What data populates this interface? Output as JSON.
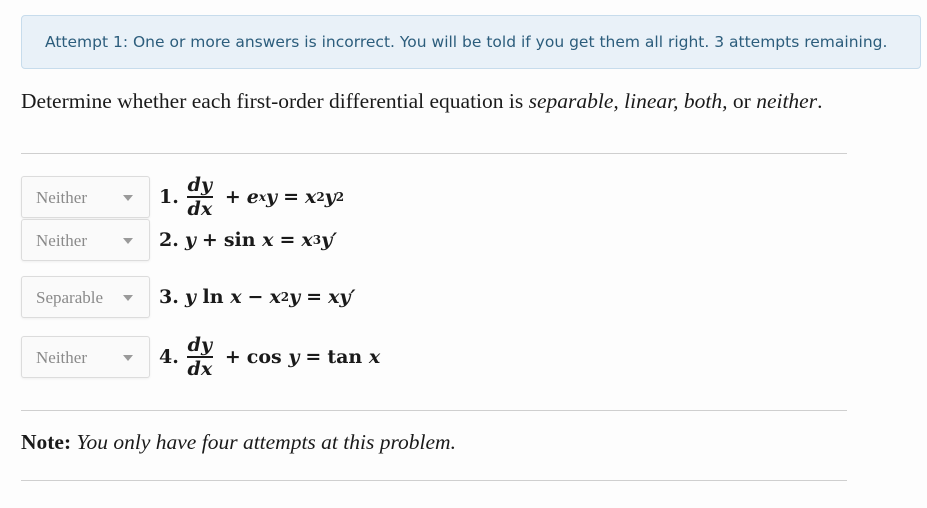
{
  "alert": {
    "text": "Attempt 1: One or more answers is incorrect. You will be told if you get them all right. 3 attempts remaining."
  },
  "question": {
    "prefix": "Determine whether each first-order differential equation is ",
    "opt1": "separable,",
    "opt2": "linear,",
    "opt3": "both,",
    "or": " or ",
    "opt4": "neither",
    "suffix": "."
  },
  "items": [
    {
      "number": "1.",
      "answer": "Neither"
    },
    {
      "number": "2.",
      "answer": "Neither"
    },
    {
      "number": "3.",
      "answer": "Separable"
    },
    {
      "number": "4.",
      "answer": "Neither"
    }
  ],
  "equations": {
    "e1": {
      "num": "dy",
      "den": "dx",
      "plus": "+",
      "e": "e",
      "x_sup": "x",
      "y": "y",
      "eq": "=",
      "x": "x",
      "two_a": "2",
      "y2": "y",
      "two_b": "2"
    },
    "e2": {
      "y": "y",
      "plus": "+",
      "sin": "sin",
      "x": "x",
      "eq": "=",
      "x2": "x",
      "three": "3",
      "yp": "y′"
    },
    "e3": {
      "y": "y",
      "ln": "ln",
      "x": "x",
      "minus": "−",
      "x2": "x",
      "two": "2",
      "y2": "y",
      "eq": "=",
      "xy": "xy′"
    },
    "e4": {
      "num": "dy",
      "den": "dx",
      "plus": "+",
      "cos": "cos",
      "y": "y",
      "eq": "=",
      "tan": "tan",
      "x": "x"
    }
  },
  "note": {
    "label": "Note:",
    "text": "You only have four attempts at this problem."
  }
}
